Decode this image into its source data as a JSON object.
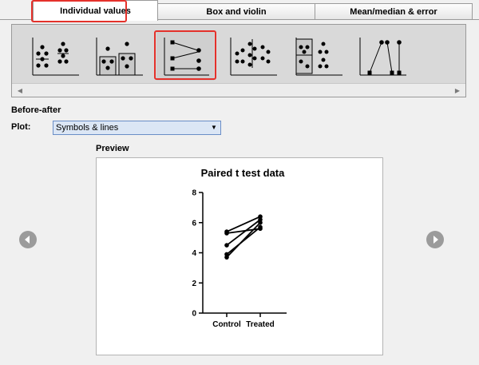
{
  "tabs": [
    {
      "label": "Individual values",
      "active": true
    },
    {
      "label": "Box and violin",
      "active": false
    },
    {
      "label": "Mean/median & error",
      "active": false
    }
  ],
  "gallery": {
    "selected_index": 2,
    "thumbnails": [
      {
        "name": "scatter-dot-plot"
      },
      {
        "name": "scatter-bar-plot"
      },
      {
        "name": "before-after-plot"
      },
      {
        "name": "interleaved-scatter-plot"
      },
      {
        "name": "scatter-box-plot"
      },
      {
        "name": "estimation-plot"
      }
    ]
  },
  "section_title": "Before-after",
  "plot": {
    "label": "Plot:",
    "selected": "Symbols & lines"
  },
  "preview_label": "Preview",
  "colors": {
    "highlight": "#e4312b",
    "select_bg": "#dbe6f5",
    "nav_button": "#9b9b9b"
  },
  "chart_data": {
    "type": "line",
    "title": "Paired t test data",
    "categories": [
      "Control",
      "Treated"
    ],
    "ylim": [
      0,
      8
    ],
    "yticks": [
      "0",
      "2",
      "4",
      "6",
      "8"
    ],
    "series": [
      {
        "values": [
          5.4,
          6.4
        ]
      },
      {
        "values": [
          5.3,
          5.6
        ]
      },
      {
        "values": [
          4.5,
          6.2
        ]
      },
      {
        "values": [
          3.9,
          5.7
        ]
      },
      {
        "values": [
          3.7,
          6.0
        ]
      }
    ],
    "grid": false,
    "legend": "none"
  }
}
